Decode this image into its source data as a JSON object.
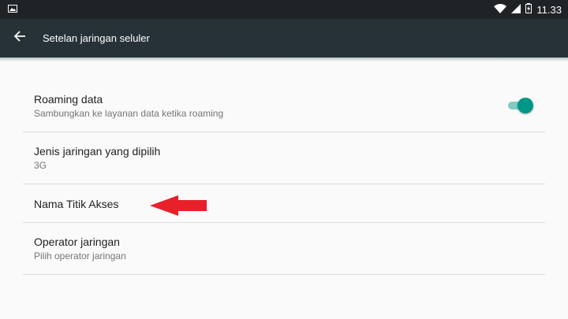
{
  "status_bar": {
    "time": "11.33",
    "icons": [
      "image-notification-icon",
      "wifi-icon",
      "cell-signal-icon",
      "battery-charging-icon"
    ]
  },
  "app_bar": {
    "back_icon": "arrow-back-icon",
    "title": "Setelan jaringan seluler"
  },
  "settings": [
    {
      "title": "Roaming data",
      "subtitle": "Sambungkan ke layanan data ketika roaming",
      "toggle": true
    },
    {
      "title": "Jenis jaringan yang dipilih",
      "subtitle": "3G"
    },
    {
      "title": "Nama Titik Akses"
    },
    {
      "title": "Operator jaringan",
      "subtitle": "Pilih operator jaringan"
    }
  ],
  "colors": {
    "status_bar": "#1f2326",
    "app_bar": "#263238",
    "accent": "#009688",
    "annotation": "#e8202a"
  }
}
